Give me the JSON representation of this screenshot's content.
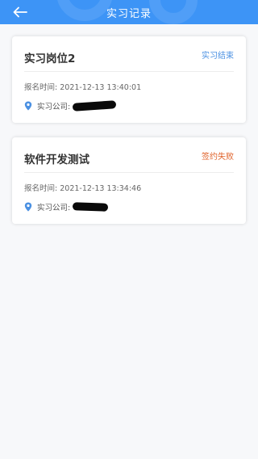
{
  "header": {
    "title": "实习记录",
    "back_icon": "arrow-left-icon",
    "color": "#3d94f6"
  },
  "records": [
    {
      "title": "实习岗位2",
      "status": "实习结束",
      "status_color": "#4a90e2",
      "time_label": "报名时间:",
      "time_value": "2021-12-13 13:40:01",
      "company_label": "实习公司:",
      "location_icon": "location-pin-icon"
    },
    {
      "title": "软件开发测试",
      "status": "签约失败",
      "status_color": "#e0622a",
      "time_label": "报名时间:",
      "time_value": "2021-12-13 13:34:46",
      "company_label": "实习公司:",
      "location_icon": "location-pin-icon"
    }
  ]
}
